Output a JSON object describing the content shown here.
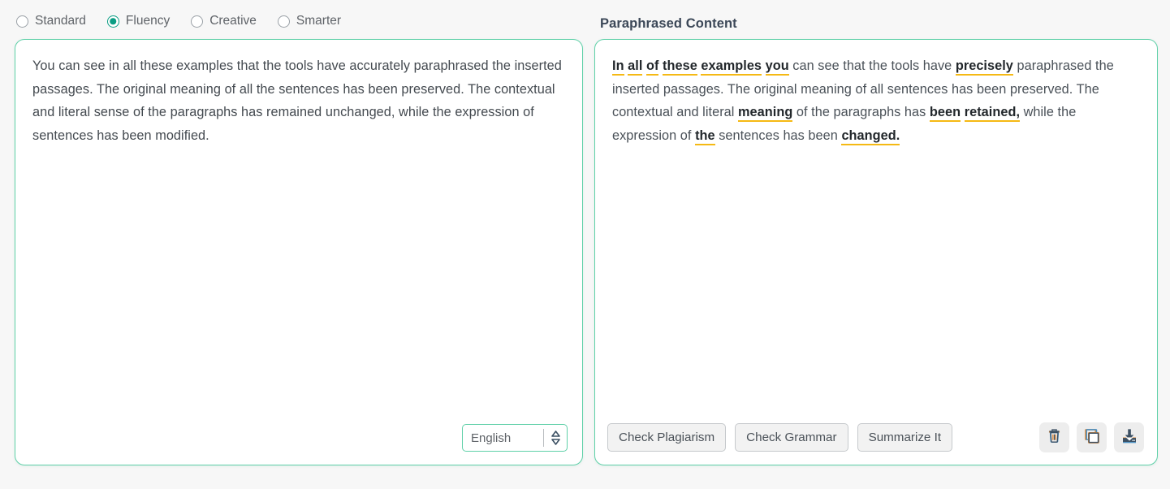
{
  "modes": {
    "options": [
      {
        "label": "Standard",
        "selected": false
      },
      {
        "label": "Fluency",
        "selected": true
      },
      {
        "label": "Creative",
        "selected": false
      },
      {
        "label": "Smarter",
        "selected": false
      }
    ]
  },
  "right_panel": {
    "header": "Paraphrased Content",
    "segments": [
      {
        "text": "In",
        "highlight": true
      },
      {
        "text": " ",
        "highlight": false
      },
      {
        "text": "all",
        "highlight": true
      },
      {
        "text": " ",
        "highlight": false
      },
      {
        "text": "of",
        "highlight": true
      },
      {
        "text": " ",
        "highlight": false
      },
      {
        "text": "these",
        "highlight": true
      },
      {
        "text": " ",
        "highlight": false
      },
      {
        "text": "examples",
        "highlight": true
      },
      {
        "text": " ",
        "highlight": false
      },
      {
        "text": "you",
        "highlight": true
      },
      {
        "text": " can see that the tools have ",
        "highlight": false
      },
      {
        "text": "precisely",
        "highlight": true
      },
      {
        "text": " paraphrased the inserted passages. The original meaning of all sentences has been preserved. The contextual and literal ",
        "highlight": false
      },
      {
        "text": "meaning",
        "highlight": true
      },
      {
        "text": " of the paragraphs has ",
        "highlight": false
      },
      {
        "text": "been",
        "highlight": true
      },
      {
        "text": " ",
        "highlight": false
      },
      {
        "text": "retained,",
        "highlight": true
      },
      {
        "text": " while the expression of ",
        "highlight": false
      },
      {
        "text": "the",
        "highlight": true
      },
      {
        "text": " sentences has been ",
        "highlight": false
      },
      {
        "text": "changed.",
        "highlight": true
      }
    ],
    "actions": [
      {
        "label": "Check Plagiarism",
        "name": "check-plagiarism-button"
      },
      {
        "label": "Check Grammar",
        "name": "check-grammar-button"
      },
      {
        "label": "Summarize It",
        "name": "summarize-it-button"
      }
    ],
    "icons": [
      {
        "name": "trash-icon",
        "title": "Delete"
      },
      {
        "name": "copy-icon",
        "title": "Copy"
      },
      {
        "name": "download-icon",
        "title": "Download"
      }
    ]
  },
  "left_panel": {
    "text": "You can see in all these examples that the tools have accurately paraphrased the inserted passages. The original meaning of all the sentences has been preserved. The contextual and literal sense of the paragraphs has remained unchanged, while the expression of sentences has been modified.",
    "language": {
      "value": "English",
      "stepper_icon": "chevron-up-down-icon"
    }
  },
  "colors": {
    "accent_teal": "#0a9d83",
    "panel_border": "#5fd0a8",
    "highlight_underline": "#f5b914",
    "page_background": "#f7f7f7",
    "text": "#444a50",
    "icon_dark": "#3c5063",
    "icon_orange": "#e08b3a",
    "icon_blue": "#4a90c4"
  }
}
